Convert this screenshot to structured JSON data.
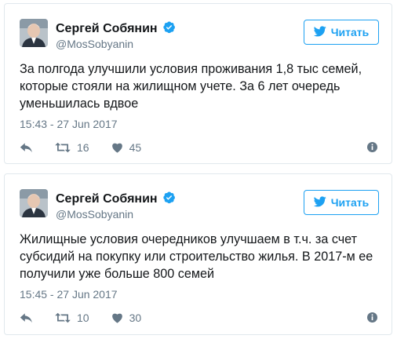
{
  "tweets": [
    {
      "author_name": "Сергей Собянин",
      "handle": "@MosSobyanin",
      "follow_label": "Читать",
      "text": "За полгода улучшили условия проживания 1,8 тыс семей, которые стояли на жилищном учете. За 6 лет очередь уменьшилась вдвое",
      "timestamp": "15:43 - 27 Jun 2017",
      "retweets": "16",
      "likes": "45"
    },
    {
      "author_name": "Сергей Собянин",
      "handle": "@MosSobyanin",
      "follow_label": "Читать",
      "text": "Жилищные условия очередников улучшаем в т.ч. за счет субсидий на покупку или строительство жилья. В 2017-м ее получили уже больше 800 семей",
      "timestamp": "15:45 - 27 Jun 2017",
      "retweets": "10",
      "likes": "30"
    }
  ],
  "colors": {
    "accent": "#1da1f2",
    "secondary_text": "#657786",
    "border": "#e1e8ed"
  },
  "icons": [
    "verified-icon",
    "twitter-bird-icon",
    "reply-icon",
    "retweet-icon",
    "like-icon",
    "info-icon"
  ]
}
